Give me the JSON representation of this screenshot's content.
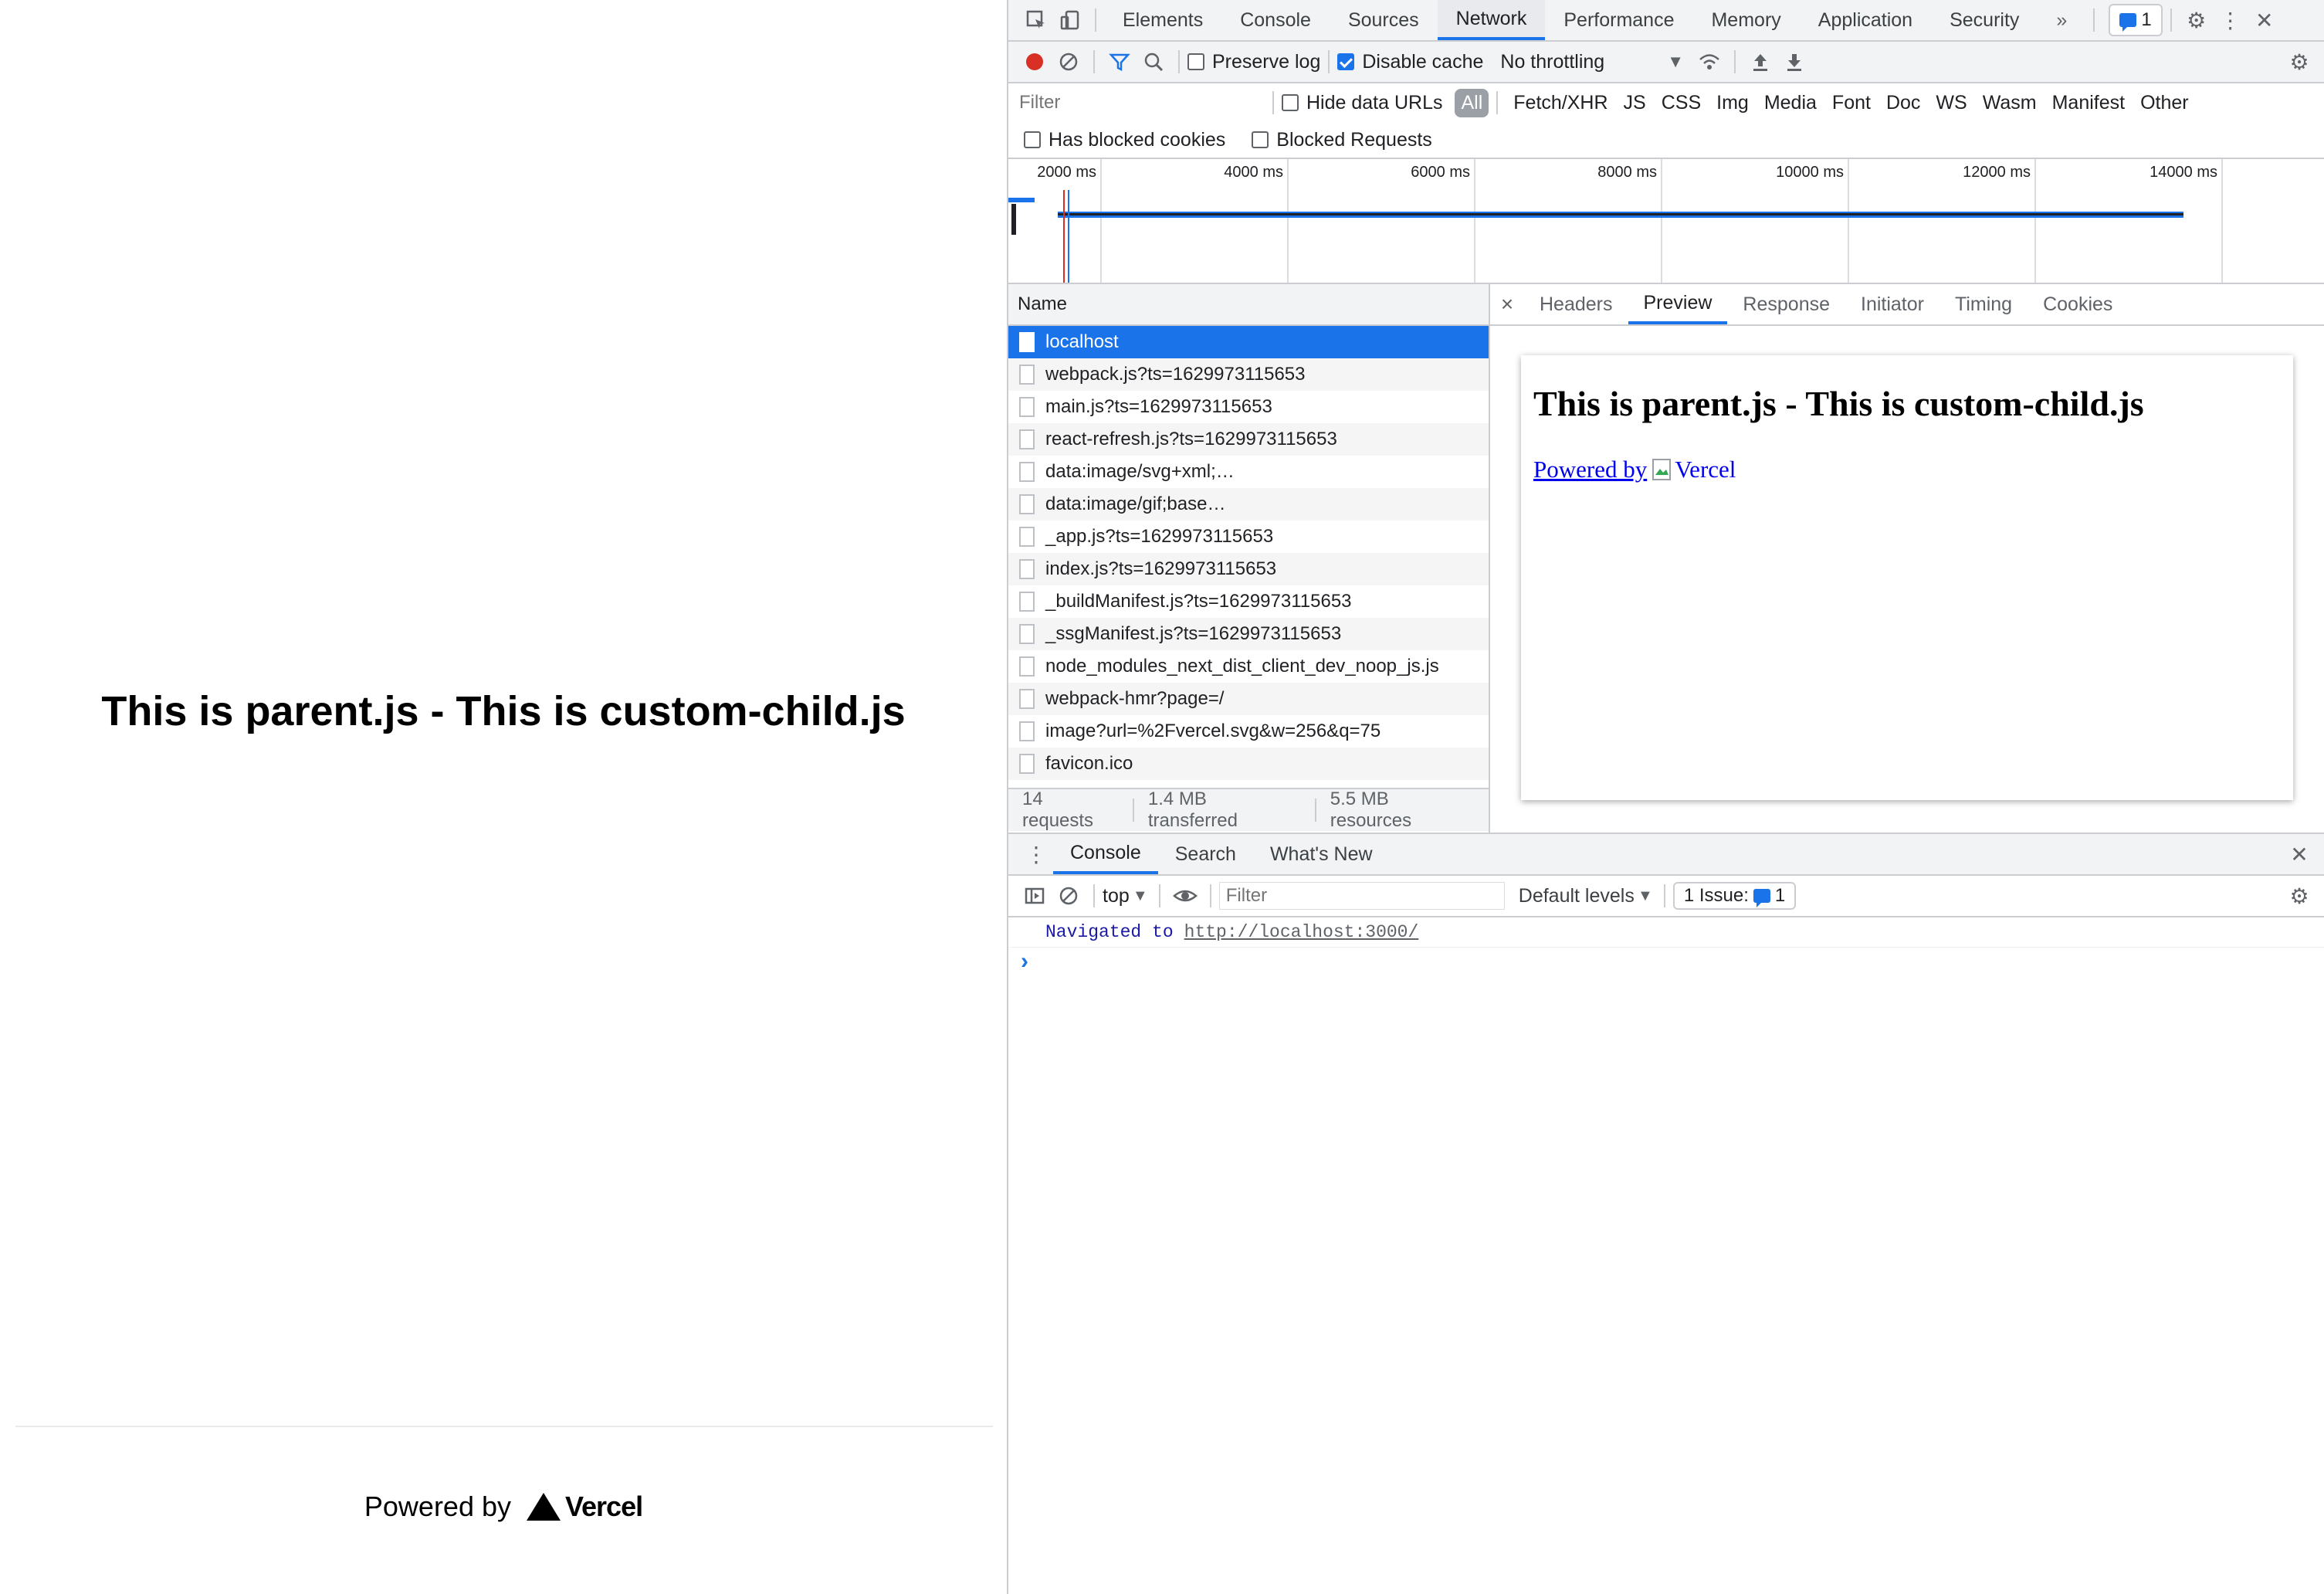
{
  "page": {
    "heading": "This is parent.js - This is custom-child.js",
    "footer_text": "Powered by",
    "footer_logo": "Vercel"
  },
  "devtools": {
    "main_tabs": [
      "Elements",
      "Console",
      "Sources",
      "Network",
      "Performance",
      "Memory",
      "Application",
      "Security"
    ],
    "active_tab": "Network",
    "more_tabs": "»",
    "issues_badge": "1",
    "toolbar": {
      "preserve_log": "Preserve log",
      "disable_cache": "Disable cache",
      "throttling": "No throttling"
    },
    "filter_bar": {
      "placeholder": "Filter",
      "hide_data_urls": "Hide data URLs",
      "types": [
        "All",
        "Fetch/XHR",
        "JS",
        "CSS",
        "Img",
        "Media",
        "Font",
        "Doc",
        "WS",
        "Wasm",
        "Manifest",
        "Other"
      ]
    },
    "cookie_filters": {
      "blocked_cookies": "Has blocked cookies",
      "blocked_requests": "Blocked Requests"
    },
    "timeline": {
      "ticks": [
        "2000 ms",
        "4000 ms",
        "6000 ms",
        "8000 ms",
        "10000 ms",
        "12000 ms",
        "14000 ms"
      ]
    },
    "requests": {
      "header": "Name",
      "items": [
        "localhost",
        "webpack.js?ts=1629973115653",
        "main.js?ts=1629973115653",
        "react-refresh.js?ts=1629973115653",
        "data:image/svg+xml;…",
        "data:image/gif;base…",
        "_app.js?ts=1629973115653",
        "index.js?ts=1629973115653",
        "_buildManifest.js?ts=1629973115653",
        "_ssgManifest.js?ts=1629973115653",
        "node_modules_next_dist_client_dev_noop_js.js",
        "webpack-hmr?page=/",
        "image?url=%2Fvercel.svg&w=256&q=75",
        "favicon.ico"
      ],
      "summary": {
        "count": "14 requests",
        "transferred": "1.4 MB transferred",
        "resources": "5.5 MB resources"
      }
    },
    "detail": {
      "close": "×",
      "tabs": [
        "Headers",
        "Preview",
        "Response",
        "Initiator",
        "Timing",
        "Cookies"
      ],
      "active_tab": "Preview",
      "preview_heading": "This is parent.js - This is custom-child.js",
      "preview_link": "Powered by",
      "preview_alt": "Vercel"
    },
    "drawer": {
      "tabs": [
        "Console",
        "Search",
        "What's New"
      ],
      "active_tab": "Console",
      "context": "top",
      "filter_placeholder": "Filter",
      "levels": "Default levels",
      "issues_label": "1 Issue:",
      "issues_count": "1",
      "log_prefix": "Navigated to",
      "log_url": "http://localhost:3000/",
      "prompt": "›"
    }
  }
}
